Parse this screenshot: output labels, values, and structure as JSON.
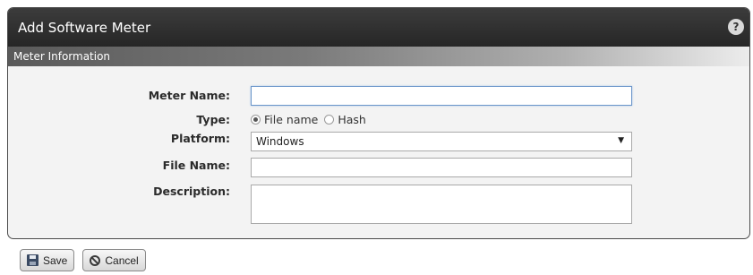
{
  "dialog": {
    "title": "Add Software Meter",
    "help_icon": "?",
    "section_title": "Meter Information"
  },
  "form": {
    "meter_name": {
      "label": "Meter Name:",
      "value": ""
    },
    "type": {
      "label": "Type:",
      "options": [
        "File name",
        "Hash"
      ],
      "selected": "File name"
    },
    "platform": {
      "label": "Platform:",
      "value": "Windows"
    },
    "file_name": {
      "label": "File Name:",
      "value": ""
    },
    "description": {
      "label": "Description:",
      "value": ""
    }
  },
  "buttons": {
    "save_label": "Save",
    "cancel_label": "Cancel"
  },
  "icons": {
    "help": "help-icon",
    "save": "floppy-disk-icon",
    "cancel": "cancel-circle-icon",
    "dropdown": "dropdown-arrow-icon"
  }
}
